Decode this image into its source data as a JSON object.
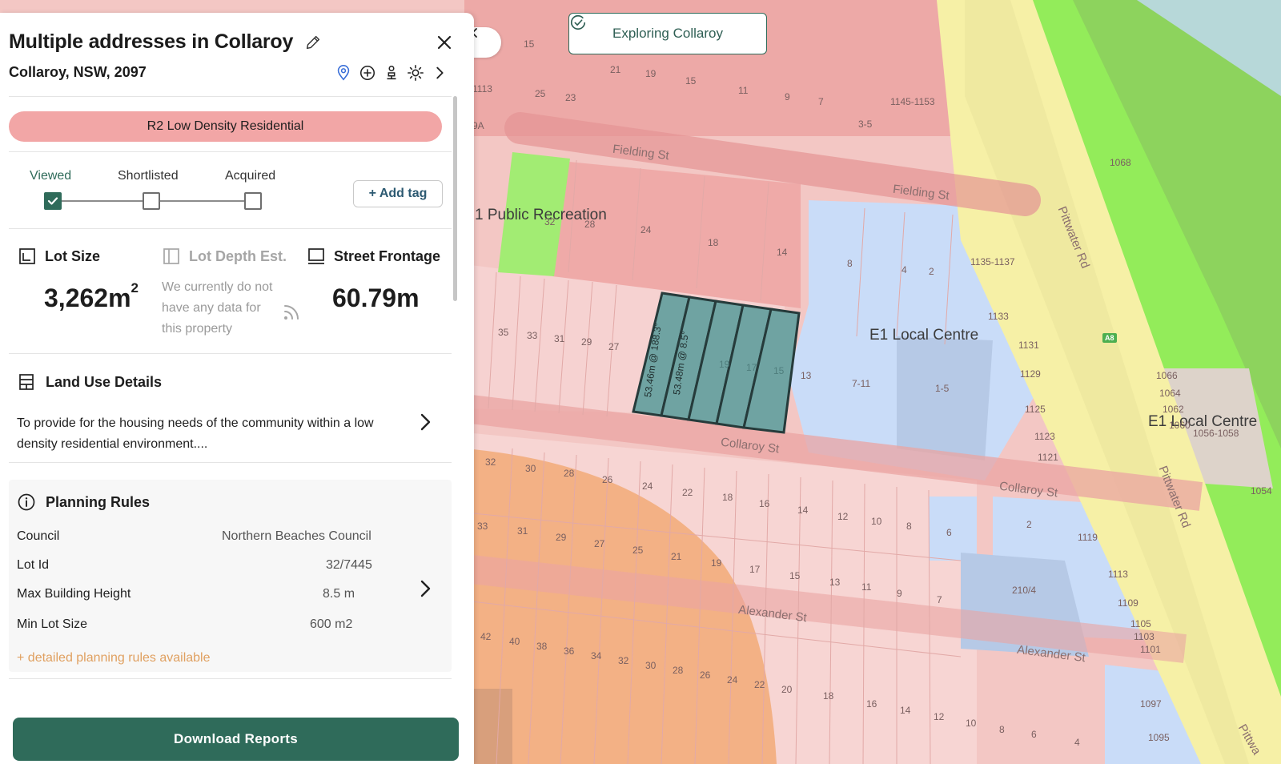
{
  "panel": {
    "title": "Multiple addresses in Collaroy",
    "subtitle": "Collaroy, NSW, 2097",
    "zone": "R2 Low Density Residential",
    "tags": {
      "viewed": "Viewed",
      "shortlisted": "Shortlisted",
      "acquired": "Acquired",
      "add_tag": "+ Add tag"
    },
    "lot_size": {
      "label": "Lot Size",
      "value": "3,262m",
      "unit_sup": "2"
    },
    "lot_depth": {
      "label": "Lot Depth Est.",
      "note": "We currently do not have any data for this property"
    },
    "street_frontage": {
      "label": "Street Frontage",
      "value": "60.79m"
    },
    "land_use": {
      "title": "Land Use Details",
      "text": "To provide for the housing needs of the community within a low density residential environment...."
    },
    "planning": {
      "title": "Planning Rules",
      "rows": [
        {
          "key": "Council",
          "value": "Northern Beaches Council"
        },
        {
          "key": "Lot Id",
          "value": "32/7445"
        },
        {
          "key": "Max Building Height",
          "value": "8.5 m"
        },
        {
          "key": "Min Lot Size",
          "value": "600 m2"
        }
      ],
      "more": "+ detailed planning rules available"
    },
    "download": "Download Reports"
  },
  "map": {
    "explore_chip": "Exploring Collaroy",
    "zones": {
      "public_recreation": "1 Public Recreation",
      "local_centre_1": "E1 Local Centre",
      "local_centre_2": "E1 Local Centre"
    },
    "streets": {
      "fielding_1": "Fielding St",
      "fielding_2": "Fielding St",
      "collaroy_1": "Collaroy St",
      "collaroy_2": "Collaroy St",
      "alexander_1": "Alexander St",
      "alexander_2": "Alexander St",
      "pittwater_1": "Pittwater Rd",
      "pittwater_2": "Pittwater Rd",
      "pittwater_3": "Pittwa"
    },
    "road_badge": "A8",
    "measurements": {
      "m1": "53.46m @ 188.3°",
      "m2": "53.48m @ 8.5°"
    },
    "lot_numbers": {
      "n15": "15",
      "n21": "21",
      "n19": "19",
      "n15b": "15",
      "n11": "11",
      "n9": "9",
      "n7": "7",
      "n1113": "1113",
      "n25": "25",
      "n23": "23",
      "n1145": "1145-1153",
      "n35a": "3-5",
      "n9a": "9A",
      "n1068": "1068",
      "n32": "32",
      "n28": "28",
      "n24": "24",
      "n18": "18",
      "n14": "14",
      "n8": "8",
      "n4": "4",
      "n2": "2",
      "n1135": "1135-1137",
      "n1133": "1133",
      "n35": "35",
      "n33": "33",
      "n31": "31",
      "n29": "29",
      "n27": "27",
      "n19b": "19",
      "n17": "17",
      "n15c": "15",
      "n13": "13",
      "n711": "7-11",
      "n15d": "1-5",
      "n1131": "1131",
      "n1129": "1129",
      "n1125": "1125",
      "n1123": "1123",
      "n1121": "1121",
      "n1066": "1066",
      "n1064": "1064",
      "n1062": "1062",
      "n1060": "1060",
      "n1056": "1056-1058",
      "n1054": "1054",
      "n32b": "32",
      "n30": "30",
      "n28b": "28",
      "n26": "26",
      "n24b": "24",
      "n22": "22",
      "n18b": "18",
      "n16": "16",
      "n14b": "14",
      "n12": "12",
      "n10": "10",
      "n8b": "8",
      "n6": "6",
      "n2b": "2",
      "n1119": "1119",
      "n33b": "33",
      "n31b": "31",
      "n29b": "29",
      "n27b": "27",
      "n25b": "25",
      "n21b": "21",
      "n19c": "19",
      "n17b": "17",
      "n15e": "15",
      "n13b": "13",
      "n11b": "11",
      "n9b": "9",
      "n7b": "7",
      "n2104": "210/4",
      "n1109": "1109",
      "n1105": "1105",
      "n1103": "1103",
      "n1101": "1101",
      "n42": "42",
      "n40": "40",
      "n38": "38",
      "n36": "36",
      "n34": "34",
      "n32c": "32",
      "n30b": "30",
      "n28c": "28",
      "n26b": "26",
      "n24c": "24",
      "n22b": "22",
      "n20": "20",
      "n18c": "18",
      "n16b": "16",
      "n14c": "14",
      "n12b": "12",
      "n10b": "10",
      "n8c": "8",
      "n6b": "6",
      "n4b": "4",
      "n1097": "1097",
      "n1095": "1095"
    }
  }
}
